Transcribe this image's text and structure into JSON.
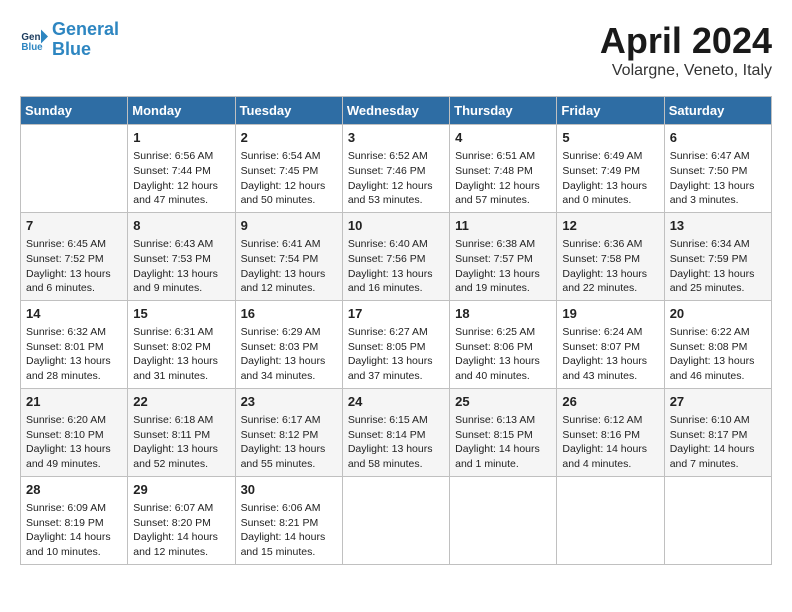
{
  "header": {
    "logo_line1": "General",
    "logo_line2": "Blue",
    "title": "April 2024",
    "subtitle": "Volargne, Veneto, Italy"
  },
  "days_of_week": [
    "Sunday",
    "Monday",
    "Tuesday",
    "Wednesday",
    "Thursday",
    "Friday",
    "Saturday"
  ],
  "weeks": [
    [
      {
        "day": "",
        "info": ""
      },
      {
        "day": "1",
        "info": "Sunrise: 6:56 AM\nSunset: 7:44 PM\nDaylight: 12 hours\nand 47 minutes."
      },
      {
        "day": "2",
        "info": "Sunrise: 6:54 AM\nSunset: 7:45 PM\nDaylight: 12 hours\nand 50 minutes."
      },
      {
        "day": "3",
        "info": "Sunrise: 6:52 AM\nSunset: 7:46 PM\nDaylight: 12 hours\nand 53 minutes."
      },
      {
        "day": "4",
        "info": "Sunrise: 6:51 AM\nSunset: 7:48 PM\nDaylight: 12 hours\nand 57 minutes."
      },
      {
        "day": "5",
        "info": "Sunrise: 6:49 AM\nSunset: 7:49 PM\nDaylight: 13 hours\nand 0 minutes."
      },
      {
        "day": "6",
        "info": "Sunrise: 6:47 AM\nSunset: 7:50 PM\nDaylight: 13 hours\nand 3 minutes."
      }
    ],
    [
      {
        "day": "7",
        "info": "Sunrise: 6:45 AM\nSunset: 7:52 PM\nDaylight: 13 hours\nand 6 minutes."
      },
      {
        "day": "8",
        "info": "Sunrise: 6:43 AM\nSunset: 7:53 PM\nDaylight: 13 hours\nand 9 minutes."
      },
      {
        "day": "9",
        "info": "Sunrise: 6:41 AM\nSunset: 7:54 PM\nDaylight: 13 hours\nand 12 minutes."
      },
      {
        "day": "10",
        "info": "Sunrise: 6:40 AM\nSunset: 7:56 PM\nDaylight: 13 hours\nand 16 minutes."
      },
      {
        "day": "11",
        "info": "Sunrise: 6:38 AM\nSunset: 7:57 PM\nDaylight: 13 hours\nand 19 minutes."
      },
      {
        "day": "12",
        "info": "Sunrise: 6:36 AM\nSunset: 7:58 PM\nDaylight: 13 hours\nand 22 minutes."
      },
      {
        "day": "13",
        "info": "Sunrise: 6:34 AM\nSunset: 7:59 PM\nDaylight: 13 hours\nand 25 minutes."
      }
    ],
    [
      {
        "day": "14",
        "info": "Sunrise: 6:32 AM\nSunset: 8:01 PM\nDaylight: 13 hours\nand 28 minutes."
      },
      {
        "day": "15",
        "info": "Sunrise: 6:31 AM\nSunset: 8:02 PM\nDaylight: 13 hours\nand 31 minutes."
      },
      {
        "day": "16",
        "info": "Sunrise: 6:29 AM\nSunset: 8:03 PM\nDaylight: 13 hours\nand 34 minutes."
      },
      {
        "day": "17",
        "info": "Sunrise: 6:27 AM\nSunset: 8:05 PM\nDaylight: 13 hours\nand 37 minutes."
      },
      {
        "day": "18",
        "info": "Sunrise: 6:25 AM\nSunset: 8:06 PM\nDaylight: 13 hours\nand 40 minutes."
      },
      {
        "day": "19",
        "info": "Sunrise: 6:24 AM\nSunset: 8:07 PM\nDaylight: 13 hours\nand 43 minutes."
      },
      {
        "day": "20",
        "info": "Sunrise: 6:22 AM\nSunset: 8:08 PM\nDaylight: 13 hours\nand 46 minutes."
      }
    ],
    [
      {
        "day": "21",
        "info": "Sunrise: 6:20 AM\nSunset: 8:10 PM\nDaylight: 13 hours\nand 49 minutes."
      },
      {
        "day": "22",
        "info": "Sunrise: 6:18 AM\nSunset: 8:11 PM\nDaylight: 13 hours\nand 52 minutes."
      },
      {
        "day": "23",
        "info": "Sunrise: 6:17 AM\nSunset: 8:12 PM\nDaylight: 13 hours\nand 55 minutes."
      },
      {
        "day": "24",
        "info": "Sunrise: 6:15 AM\nSunset: 8:14 PM\nDaylight: 13 hours\nand 58 minutes."
      },
      {
        "day": "25",
        "info": "Sunrise: 6:13 AM\nSunset: 8:15 PM\nDaylight: 14 hours\nand 1 minute."
      },
      {
        "day": "26",
        "info": "Sunrise: 6:12 AM\nSunset: 8:16 PM\nDaylight: 14 hours\nand 4 minutes."
      },
      {
        "day": "27",
        "info": "Sunrise: 6:10 AM\nSunset: 8:17 PM\nDaylight: 14 hours\nand 7 minutes."
      }
    ],
    [
      {
        "day": "28",
        "info": "Sunrise: 6:09 AM\nSunset: 8:19 PM\nDaylight: 14 hours\nand 10 minutes."
      },
      {
        "day": "29",
        "info": "Sunrise: 6:07 AM\nSunset: 8:20 PM\nDaylight: 14 hours\nand 12 minutes."
      },
      {
        "day": "30",
        "info": "Sunrise: 6:06 AM\nSunset: 8:21 PM\nDaylight: 14 hours\nand 15 minutes."
      },
      {
        "day": "",
        "info": ""
      },
      {
        "day": "",
        "info": ""
      },
      {
        "day": "",
        "info": ""
      },
      {
        "day": "",
        "info": ""
      }
    ]
  ]
}
